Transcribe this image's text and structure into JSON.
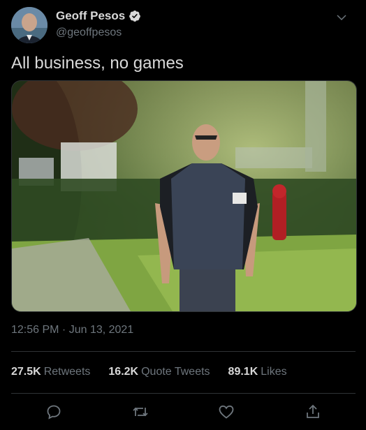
{
  "author": {
    "display_name": "Geoff Pesos",
    "handle": "@geoffpesos",
    "verified": true,
    "avatar_icon": "user-avatar"
  },
  "tweet": {
    "text": "All business, no games",
    "media_description": "photo",
    "timestamp": "12:56 PM · Jun 13, 2021"
  },
  "stats": {
    "retweets_count": "27.5K",
    "retweets_label": "Retweets",
    "quotes_count": "16.2K",
    "quotes_label": "Quote Tweets",
    "likes_count": "89.1K",
    "likes_label": "Likes"
  },
  "actions": [
    "reply-icon",
    "retweet-icon",
    "like-icon",
    "share-icon"
  ],
  "colors": {
    "background": "#000000",
    "primary_text": "#d9d9d9",
    "secondary_text": "#6e767d",
    "divider": "#2f3336",
    "verified": "#d9d9d9"
  }
}
